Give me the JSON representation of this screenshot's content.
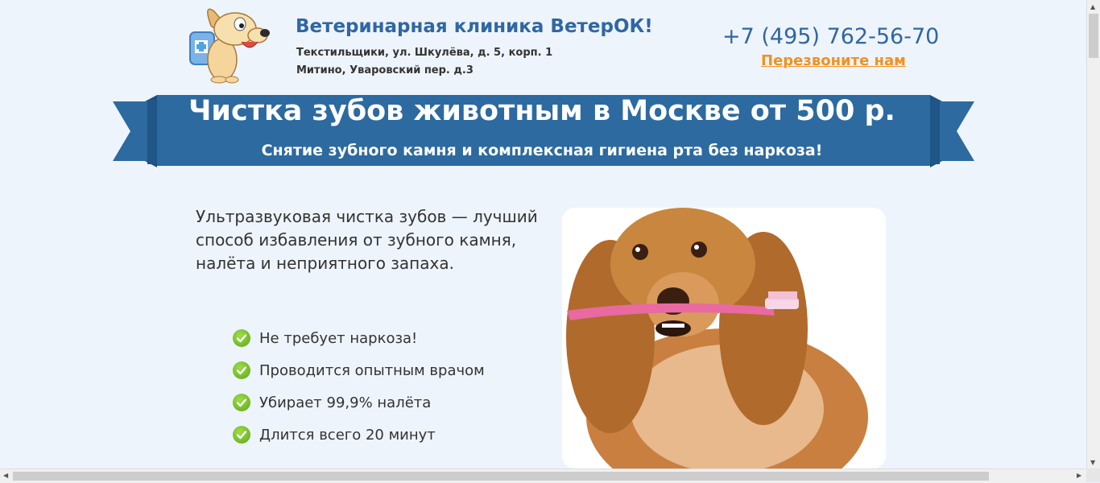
{
  "header": {
    "clinic_name": "Ветеринарная клиника ВетерОК!",
    "address_1": "Текстильщики, ул. Шкулёва, д. 5, корп. 1",
    "address_2": "Митино, Уваровский пер. д.3",
    "phone": "+7 (495) 762-56-70",
    "callback_label": "Перезвоните нам",
    "logo_icon": "dog-mascot-icon"
  },
  "banner": {
    "title": "Чистка зубов животным в Москве от 500 р.",
    "subtitle": "Снятие зубного камня и комплексная гигиена рта без наркоза!"
  },
  "main": {
    "intro": "Ультразвуковая чистка зубов — лучший способ избавления от зубного камня, налёта и неприятного запаха.",
    "features": [
      "Не требует наркоза!",
      "Проводится опытным врачом",
      "Убирает 99,9% налёта",
      "Длится всего 20 минут"
    ],
    "photo_icon": "dog-with-toothbrush-photo"
  },
  "colors": {
    "brand_blue": "#2f67a4",
    "ribbon_blue": "#2c6aa0",
    "accent_orange": "#f0921f",
    "check_green": "#6dbb1f",
    "background": "#eef4fb"
  }
}
